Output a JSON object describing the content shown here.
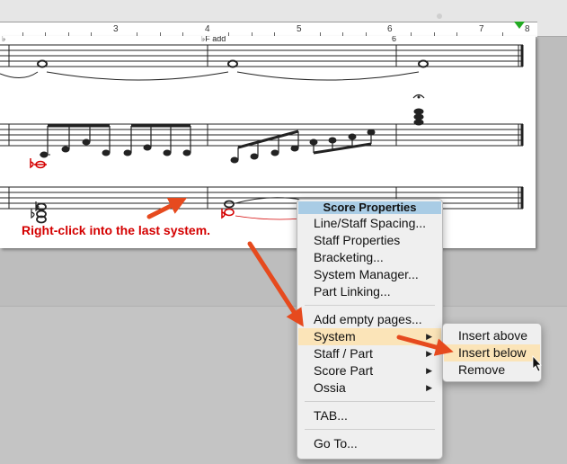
{
  "ruler": {
    "numbers": [
      "3",
      "4",
      "5",
      "6",
      "7",
      "8"
    ]
  },
  "score": {
    "fragment_left": "♭",
    "fragment_mid": "♭F add",
    "fragment_right": "6"
  },
  "annotation": {
    "text": "Right-click into the last system.",
    "color": "#d40000"
  },
  "context_menu": {
    "header": "Score Properties",
    "items": [
      {
        "label": "Line/Staff Spacing...",
        "submenu": false
      },
      {
        "label": "Staff Properties",
        "submenu": false
      },
      {
        "label": "Bracketing...",
        "submenu": false
      },
      {
        "label": "System Manager...",
        "submenu": false
      },
      {
        "label": "Part Linking...",
        "submenu": false
      },
      {
        "label": "Add empty pages...",
        "submenu": false
      },
      {
        "label": "System",
        "submenu": true,
        "highlighted": true
      },
      {
        "label": "Staff / Part",
        "submenu": true
      },
      {
        "label": "Score Part",
        "submenu": true
      },
      {
        "label": "Ossia",
        "submenu": true
      },
      {
        "label": "TAB...",
        "submenu": false
      },
      {
        "label": "Go To...",
        "submenu": false
      }
    ],
    "submenu_arrow": "▶"
  },
  "system_submenu": {
    "items": [
      {
        "label": "Insert above"
      },
      {
        "label": "Insert below",
        "highlighted": true
      },
      {
        "label": "Remove"
      }
    ]
  },
  "colors": {
    "highlight": "#fbe4b8",
    "header": "#a9cce5",
    "arrow": "#e64a1e",
    "note_red": "#d40000",
    "ruler_marker": "#22aa22"
  }
}
